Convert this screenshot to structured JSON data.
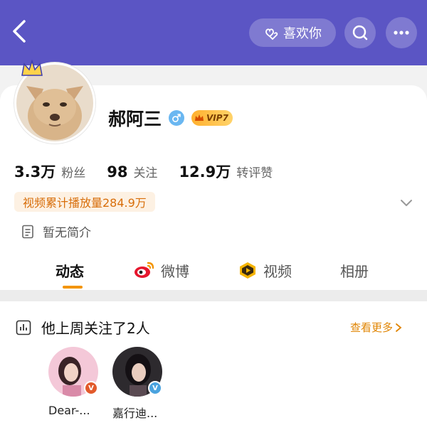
{
  "header": {
    "back_icon": "chevron-left-icon",
    "like_label": "喜欢你",
    "like_icon": "hand-heart-icon",
    "search_icon": "search-icon",
    "more_icon": "more-dots-icon",
    "bg_color": "#5b55c4"
  },
  "profile": {
    "name": "郝阿三",
    "gender_icon": "male-icon",
    "vip_label": "VIP7",
    "stats": [
      {
        "value": "3.3万",
        "label": "粉丝"
      },
      {
        "value": "98",
        "label": "关注"
      },
      {
        "value": "12.9万",
        "label": "转评赞"
      }
    ],
    "play_count": "视频累计播放量284.9万",
    "bio": "暂无简介"
  },
  "tabs": [
    {
      "label": "动态",
      "icon": "",
      "active": true
    },
    {
      "label": "微博",
      "icon": "weibo-icon",
      "active": false
    },
    {
      "label": "视频",
      "icon": "video-icon",
      "active": false
    },
    {
      "label": "相册",
      "icon": "",
      "active": false
    }
  ],
  "feed": {
    "title": "他上周关注了2人",
    "see_more": "查看更多",
    "people": [
      {
        "name": "Dear-...",
        "badge_color": "#e25a2b"
      },
      {
        "name": "嘉行迪...",
        "badge_color": "#4aa3df"
      }
    ]
  },
  "colors": {
    "accent": "#f39400",
    "vip": "#ffb02e"
  }
}
